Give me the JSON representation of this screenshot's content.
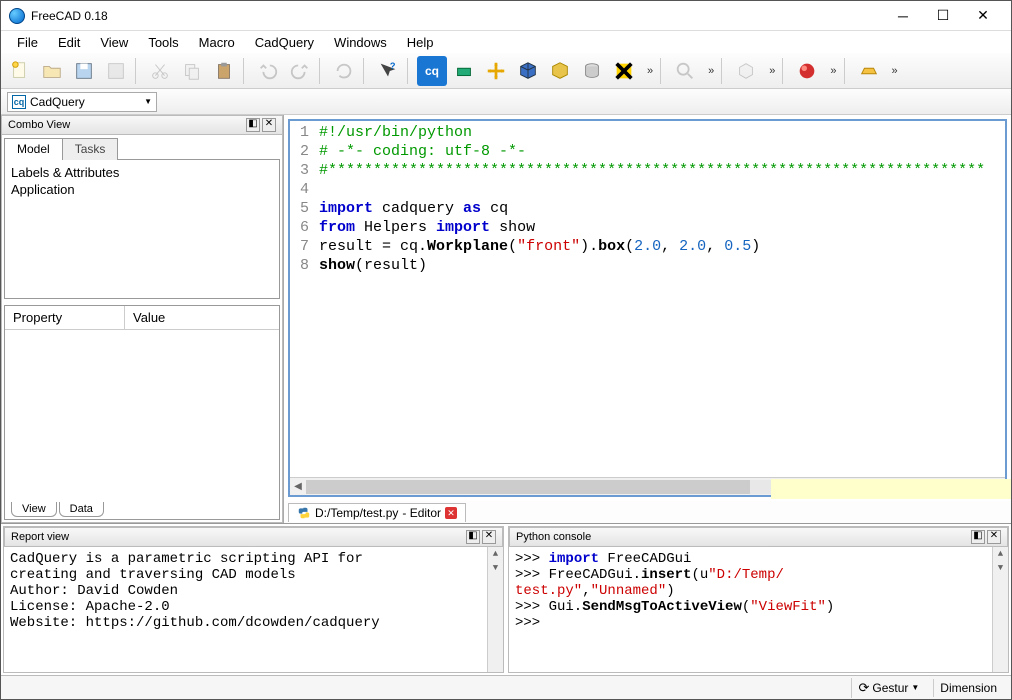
{
  "window": {
    "title": "FreeCAD 0.18"
  },
  "menu": {
    "items": [
      "File",
      "Edit",
      "View",
      "Tools",
      "Macro",
      "CadQuery",
      "Windows",
      "Help"
    ]
  },
  "workbench": {
    "icon_label": "cq",
    "name": "CadQuery"
  },
  "combo": {
    "title": "Combo View",
    "tabs": [
      "Model",
      "Tasks"
    ],
    "tree": {
      "header": "Labels & Attributes",
      "root": "Application"
    },
    "props": {
      "col1": "Property",
      "col2": "Value"
    },
    "bottom_tabs": [
      "View",
      "Data"
    ]
  },
  "editor": {
    "tab": {
      "filename": "D:/Temp/test.py",
      "suffix": " - Editor"
    },
    "lines": [
      [
        {
          "cls": "cmt",
          "t": "#!/usr/bin/python"
        }
      ],
      [
        {
          "cls": "cmt",
          "t": "# -*- coding: utf-8 -*-"
        }
      ],
      [
        {
          "cls": "cmt",
          "t": "#*************************************************************************"
        }
      ],
      [
        {
          "cls": "",
          "t": ""
        }
      ],
      [
        {
          "cls": "kw",
          "t": "import"
        },
        {
          "cls": "",
          "t": " cadquery "
        },
        {
          "cls": "kw",
          "t": "as"
        },
        {
          "cls": "",
          "t": " cq"
        }
      ],
      [
        {
          "cls": "kw",
          "t": "from"
        },
        {
          "cls": "",
          "t": " Helpers "
        },
        {
          "cls": "kw",
          "t": "import"
        },
        {
          "cls": "",
          "t": " show"
        }
      ],
      [
        {
          "cls": "",
          "t": "result = cq."
        },
        {
          "cls": "fn",
          "t": "Workplane"
        },
        {
          "cls": "",
          "t": "("
        },
        {
          "cls": "str",
          "t": "\"front\""
        },
        {
          "cls": "",
          "t": ")."
        },
        {
          "cls": "fn",
          "t": "box"
        },
        {
          "cls": "",
          "t": "("
        },
        {
          "cls": "num",
          "t": "2.0"
        },
        {
          "cls": "",
          "t": ", "
        },
        {
          "cls": "num",
          "t": "2.0"
        },
        {
          "cls": "",
          "t": ", "
        },
        {
          "cls": "num",
          "t": "0.5"
        },
        {
          "cls": "",
          "t": ")"
        }
      ],
      [
        {
          "cls": "fn",
          "t": "show"
        },
        {
          "cls": "",
          "t": "(result)"
        }
      ]
    ]
  },
  "report": {
    "title": "Report view",
    "lines": [
      "CadQuery is a parametric scripting API for",
      "creating and traversing CAD models",
      "Author: David Cowden",
      "License: Apache-2.0",
      "Website: https://github.com/dcowden/cadquery"
    ]
  },
  "console": {
    "title": "Python console",
    "lines": [
      [
        {
          "cls": "",
          "t": ">>> "
        },
        {
          "cls": "kw",
          "t": "import"
        },
        {
          "cls": "",
          "t": " FreeCADGui"
        }
      ],
      [
        {
          "cls": "",
          "t": ">>> FreeCADGui."
        },
        {
          "cls": "fn",
          "t": "insert"
        },
        {
          "cls": "",
          "t": "(u"
        },
        {
          "cls": "str",
          "t": "\"D:/Temp/"
        }
      ],
      [
        {
          "cls": "str",
          "t": "test.py\""
        },
        {
          "cls": "",
          "t": ","
        },
        {
          "cls": "str",
          "t": "\"Unnamed\""
        },
        {
          "cls": "",
          "t": ")"
        }
      ],
      [
        {
          "cls": "",
          "t": ">>> Gui."
        },
        {
          "cls": "fn",
          "t": "SendMsgToActiveView"
        },
        {
          "cls": "",
          "t": "("
        },
        {
          "cls": "str",
          "t": "\"ViewFit\""
        },
        {
          "cls": "",
          "t": ")"
        }
      ],
      [
        {
          "cls": "",
          "t": ">>> "
        }
      ]
    ]
  },
  "status": {
    "nav": "Gestur",
    "dim": "Dimension"
  }
}
